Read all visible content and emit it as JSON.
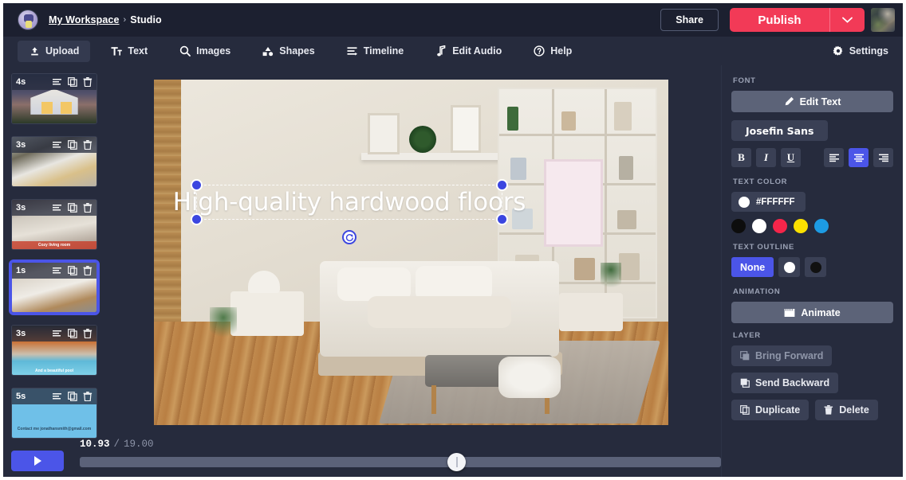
{
  "header": {
    "logo_icon": "workspace-avatar-icon",
    "breadcrumb_root": "My Workspace",
    "breadcrumb_sep": "›",
    "breadcrumb_current": "Studio",
    "share_label": "Share",
    "publish_label": "Publish",
    "publish_caret_icon": "chevron-down-icon",
    "user_avatar_icon": "user-avatar"
  },
  "nav": {
    "tabs": [
      {
        "label": "Upload",
        "icon": "upload-icon",
        "active": true
      },
      {
        "label": "Text",
        "icon": "text-icon",
        "active": false
      },
      {
        "label": "Images",
        "icon": "search-icon",
        "active": false
      },
      {
        "label": "Shapes",
        "icon": "shapes-icon",
        "active": false
      },
      {
        "label": "Timeline",
        "icon": "timeline-icon",
        "active": false
      },
      {
        "label": "Edit Audio",
        "icon": "music-note-icon",
        "active": false
      },
      {
        "label": "Help",
        "icon": "help-icon",
        "active": false
      }
    ],
    "settings_label": "Settings",
    "settings_icon": "gear-icon"
  },
  "scenes": [
    {
      "duration": "4s",
      "caption": "",
      "selected": false,
      "art": "th-house"
    },
    {
      "duration": "3s",
      "caption": "",
      "selected": false,
      "art": "th-kitchen"
    },
    {
      "duration": "3s",
      "caption": "Cozy living room",
      "selected": false,
      "art": "th-living"
    },
    {
      "duration": "1s",
      "caption": "",
      "selected": true,
      "art": "th-bed"
    },
    {
      "duration": "3s",
      "caption": "And a beautiful pool",
      "selected": false,
      "art": "th-pool"
    },
    {
      "duration": "5s",
      "caption": "Contact me\njonathansmith@gmail.com",
      "selected": false,
      "art": "th-contact"
    }
  ],
  "scene_icons": {
    "caption_icon": "caption-icon",
    "duplicate_icon": "duplicate-icon",
    "delete_icon": "trash-icon"
  },
  "player": {
    "play_icon": "play-icon",
    "current_time": "10.93",
    "time_separator": "/",
    "total_time": "19.00"
  },
  "canvas": {
    "text_overlay": "High-quality hardwood floors",
    "selection_handles": [
      "top-left",
      "top-right",
      "bottom-left",
      "bottom-right"
    ],
    "rotate_icon": "rotate-icon"
  },
  "panel": {
    "font_section_label": "FONT",
    "edit_text_label": "Edit Text",
    "edit_text_icon": "pencil-icon",
    "font_name": "Josefin Sans",
    "bold_label": "B",
    "italic_label": "I",
    "underline_label": "U",
    "align_left_icon": "align-left-icon",
    "align_center_icon": "align-center-icon",
    "align_right_icon": "align-right-icon",
    "active_align": "center",
    "text_color_label": "TEXT COLOR",
    "text_color_value": "#FFFFFF",
    "swatches": [
      "#0D0D0D",
      "#FFFFFF",
      "#F5254A",
      "#FAE000",
      "#1D9BE3"
    ],
    "text_outline_label": "TEXT OUTLINE",
    "outline_none_label": "None",
    "outline_options": [
      "none",
      "#FFFFFF",
      "#111111"
    ],
    "animation_label": "ANIMATION",
    "animate_label": "Animate",
    "animate_icon": "clapperboard-icon",
    "layer_label": "LAYER",
    "bring_forward_label": "Bring Forward",
    "bring_forward_icon": "layer-forward-icon",
    "send_backward_label": "Send Backward",
    "send_backward_icon": "layer-backward-icon",
    "duplicate_label": "Duplicate",
    "duplicate_icon": "duplicate-icon",
    "delete_label": "Delete",
    "delete_icon": "trash-icon"
  },
  "colors": {
    "app_bg": "#262b3d",
    "topbar_bg": "#1c2030",
    "accent_red": "#f23a57",
    "accent_indigo": "#4b55e8",
    "button_gray": "#3a4055"
  }
}
